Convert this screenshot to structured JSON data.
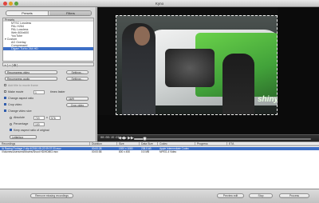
{
  "window": {
    "title": "Kyno"
  },
  "tabs": {
    "presets": "Presets",
    "filters": "Filters"
  },
  "presets": {
    "header": "Presets",
    "items": [
      {
        "label": "MTSC Lossless",
        "group": false,
        "selected": false
      },
      {
        "label": "PAL H264",
        "group": false,
        "selected": false
      },
      {
        "label": "PAL Lossless",
        "group": false,
        "selected": false
      },
      {
        "label": "Web 800x600",
        "group": false,
        "selected": false
      },
      {
        "label": "YouTube",
        "group": false,
        "selected": false
      },
      {
        "label": "▾ Custom",
        "group": true,
        "selected": false
      },
      {
        "label": "AG Overlay",
        "group": false,
        "selected": false
      },
      {
        "label": "Compressed",
        "group": false,
        "selected": false
      },
      {
        "label": "Digam Turbo 264 HD",
        "group": false,
        "selected": true
      }
    ],
    "toolbar": [
      "+",
      "−",
      "⚙"
    ]
  },
  "settings": {
    "video_popup": "Recompress video",
    "video_settings": "Settings...",
    "audio_popup": "Recompress audio",
    "audio_settings": "Settings...",
    "add_title_label": "Add title to movie frame",
    "make_movie_label": "Make movie",
    "make_movie_value": "1",
    "make_movie_suffix": "times faster",
    "change_aspect_label": "Change aspect ratio",
    "change_aspect_value": "16/9",
    "crop_label": "Crop video",
    "crop_button": "Crop video",
    "change_size_label": "Change video size",
    "absolute_label": "Absolute",
    "absolute_value": "720",
    "absolute_x": "x",
    "absolute_h": "576",
    "percentage_label": "Percentage",
    "percentage_value": "100",
    "keep_aspect_label": "Keep aspect ratio of original",
    "letterbox_popup": "Letterbox"
  },
  "player": {
    "timecode": "00:00:15:23",
    "controls": [
      "◀◀",
      "▶",
      "▶▶"
    ],
    "progress": 0.06
  },
  "table": {
    "columns": [
      "Recordings",
      "Duration",
      "Size",
      "Data Size",
      "Codec",
      "Progress",
      "ETA"
    ],
    "rows": [
      [
        "/A Racing Footage 2 clip 4/2010-05-22 09:37:33.mov",
        "00:00:28",
        "1920 x 1080",
        "238.5 kB",
        "Apple Intermediate Codec",
        "",
        ""
      ],
      [
        "/Volumes/Users/ext/Movies/Shoot HD/HDMI3.mov",
        "00:00:58",
        "800 x 450",
        "0.5 MB",
        "MPEG-4 Video",
        "",
        ""
      ]
    ]
  },
  "bottom": {
    "remove_button": "Remove missing recordings",
    "preview_button": "Preview edit",
    "stop_button": "Stop",
    "process_button": "Process"
  },
  "video": {
    "brand_text": "shiny"
  }
}
